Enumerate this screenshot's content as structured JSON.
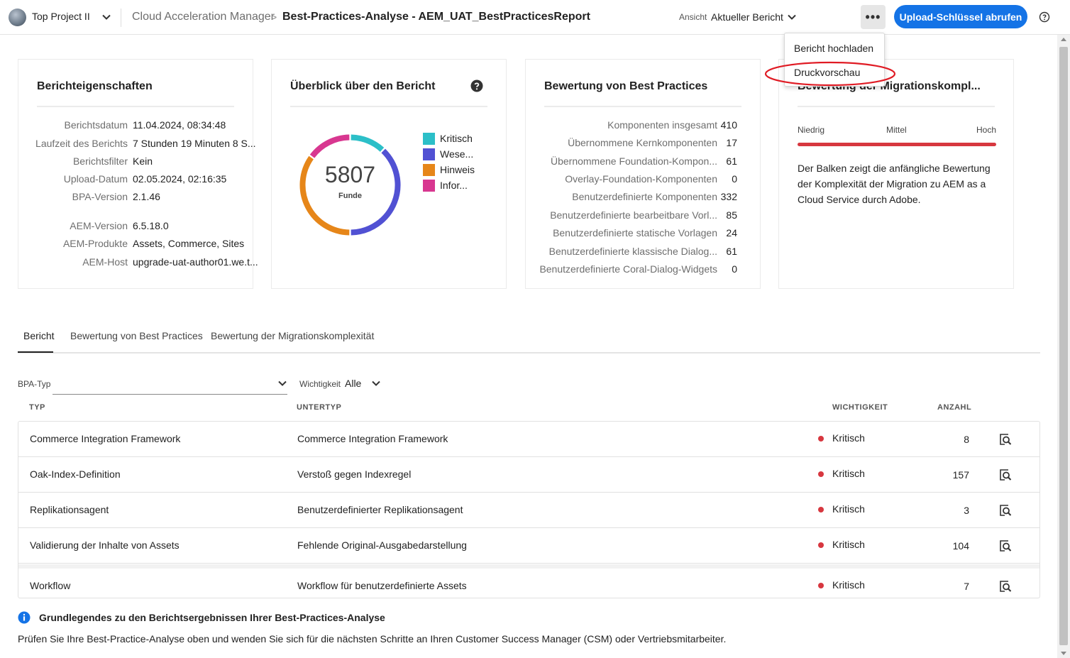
{
  "header": {
    "project": "Top Project II",
    "app_name": "Cloud Acceleration Manager",
    "breadcrumb_sep": ">",
    "page_title": "Best-Practices-Analyse - AEM_UAT_BestPracticesReport",
    "view_label": "Ansicht",
    "view_value": "Aktueller Bericht",
    "more_label": "•••",
    "upload_button": "Upload-Schlüssel abrufen"
  },
  "menu": {
    "items": [
      "Bericht hochladen",
      "Druckvorschau"
    ],
    "highlighted": "Druckvorschau",
    "highlight_color": "#e01b24"
  },
  "properties": {
    "title": "Berichteigenschaften",
    "rows": [
      {
        "label": "Berichtsdatum",
        "value": "11.04.2024, 08:34:48"
      },
      {
        "label": "Laufzeit des Berichts",
        "value": "7 Stunden 19 Minuten 8 S..."
      },
      {
        "label": "Berichtsfilter",
        "value": "Kein"
      },
      {
        "label": "Upload-Datum",
        "value": "02.05.2024, 02:16:35"
      },
      {
        "label": "BPA-Version",
        "value": "2.1.46"
      },
      {
        "label": "AEM-Version",
        "value": "6.5.18.0"
      },
      {
        "label": "AEM-Produkte",
        "value": "Assets, Commerce, Sites"
      },
      {
        "label": "AEM-Host",
        "value": "upgrade-uat-author01.we.t..."
      }
    ]
  },
  "overview": {
    "title": "Überblick über den Bericht",
    "total": "5807",
    "total_label": "Funde",
    "legend": [
      {
        "label": "Kritisch",
        "color": "#2cbfc8"
      },
      {
        "label": "Wese...",
        "color": "#5151d3"
      },
      {
        "label": "Hinweis",
        "color": "#e68619"
      },
      {
        "label": "Infor...",
        "color": "#d83790"
      }
    ]
  },
  "chart_data": {
    "type": "pie",
    "title": "Überblick über den Bericht",
    "center_value": "5807",
    "center_label": "Funde",
    "categories": [
      "Kritisch",
      "Wese...",
      "Hinweis",
      "Infor..."
    ],
    "shares": [
      0.12,
      0.38,
      0.35,
      0.15
    ],
    "colors": [
      "#2cbfc8",
      "#5151d3",
      "#e68619",
      "#d83790"
    ],
    "legend": "right"
  },
  "best_practices": {
    "title": "Bewertung von Best Practices",
    "rows": [
      {
        "label": "Komponenten insgesamt",
        "value": "410"
      },
      {
        "label": "Übernommene Kernkomponenten",
        "value": "17"
      },
      {
        "label": "Übernommene Foundation-Kompon...",
        "value": "61"
      },
      {
        "label": "Overlay-Foundation-Komponenten",
        "value": "0"
      },
      {
        "label": "Benutzerdefinierte Komponenten",
        "value": "332"
      },
      {
        "label": "Benutzerdefinierte bearbeitbare Vorl...",
        "value": "85"
      },
      {
        "label": "Benutzerdefinierte statische Vorlagen",
        "value": "24"
      },
      {
        "label": "Benutzerdefinierte klassische Dialog...",
        "value": "61"
      },
      {
        "label": "Benutzerdefinierte Coral-Dialog-Widgets",
        "value": "0"
      }
    ]
  },
  "migration": {
    "title": "Bewertung der Migrationskompl...",
    "scale": [
      "Niedrig",
      "Mittel",
      "Hoch"
    ],
    "level": "Hoch",
    "bar_color": "#d7373f",
    "description": "Der Balken zeigt die anfängliche Bewertung der Komplexität der Migration zu AEM as a Cloud Service durch Adobe."
  },
  "tabs": [
    "Bericht",
    "Bewertung von Best Practices",
    "Bewertung der Migrationskomplexität"
  ],
  "filters": {
    "bpa_label": "BPA-Typ",
    "importance_label": "Wichtigkeit",
    "importance_value": "Alle"
  },
  "table": {
    "headers": [
      "TYP",
      "UNTERTYP",
      "WICHTIGKEIT",
      "ANZAHL"
    ],
    "rows": [
      {
        "type": "Commerce Integration Framework",
        "subtype": "Commerce Integration Framework",
        "importance": "Kritisch",
        "count": "8"
      },
      {
        "type": "Oak-Index-Definition",
        "subtype": "Verstoß gegen Indexregel",
        "importance": "Kritisch",
        "count": "157"
      },
      {
        "type": "Replikationsagent",
        "subtype": "Benutzerdefinierter Replikationsagent",
        "importance": "Kritisch",
        "count": "3"
      },
      {
        "type": "Validierung der Inhalte von Assets",
        "subtype": "Fehlende Original-Ausgabedarstellung",
        "importance": "Kritisch",
        "count": "104"
      },
      {
        "type": "Workflow",
        "subtype": "Workflow für benutzerdefinierte Assets",
        "importance": "Kritisch",
        "count": "7"
      }
    ]
  },
  "info": {
    "title": "Grundlegendes zu den Berichtsergebnissen Ihrer Best-Practices-Analyse",
    "text": "Prüfen Sie Ihre Best-Practice-Analyse oben und wenden Sie sich für die nächsten Schritte an Ihren Customer Success Manager (CSM) oder Vertriebsmitarbeiter."
  },
  "colors": {
    "accent": "#1473e6",
    "critical": "#d7373f"
  }
}
